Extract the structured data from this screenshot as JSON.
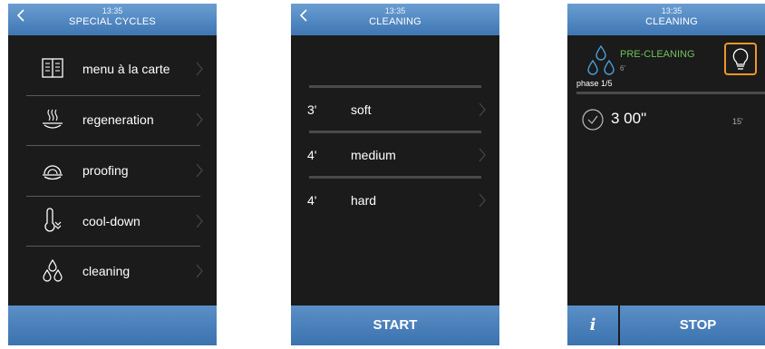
{
  "screens": {
    "special_cycles": {
      "time": "13:35",
      "title": "SPECIAL CYCLES",
      "items": [
        {
          "label": "menu à la carte",
          "icon": "book-menu-icon"
        },
        {
          "label": "regeneration",
          "icon": "regeneration-plate-icon"
        },
        {
          "label": "proofing",
          "icon": "proofing-dough-icon"
        },
        {
          "label": "cool-down",
          "icon": "thermometer-down-icon"
        },
        {
          "label": "cleaning",
          "icon": "water-drops-icon"
        }
      ]
    },
    "cleaning_select": {
      "time": "13:35",
      "title": "CLEANING",
      "options": [
        {
          "minutes": "3'",
          "label": "soft"
        },
        {
          "minutes": "4'",
          "label": "medium"
        },
        {
          "minutes": "4'",
          "label": "hard"
        }
      ],
      "start_label": "START"
    },
    "cleaning_run": {
      "time": "13:35",
      "title": "CLEANING",
      "phase_name": "PRE-CLEANING",
      "phase_minutes": "6'",
      "phase_counter": "phase 1/5",
      "timer": "3 00\"",
      "total_minutes": "15'",
      "info_label": "i",
      "stop_label": "STOP"
    }
  },
  "colors": {
    "header": "#3f76b3",
    "background": "#1b1b1b",
    "phase_green": "#6fc05a",
    "lamp_orange": "#f0962a"
  }
}
